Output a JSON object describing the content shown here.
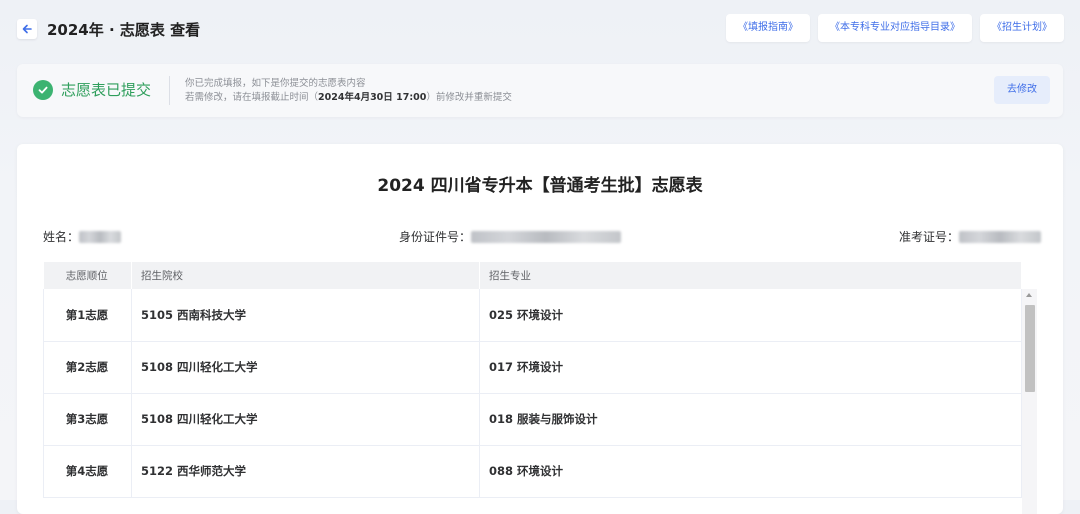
{
  "header": {
    "title": "2024年 · 志愿表 查看",
    "links": [
      "《填报指南》",
      "《本专科专业对应指导目录》",
      "《招生计划》"
    ]
  },
  "status": {
    "title": "志愿表已提交",
    "desc_line1": "你已完成填报，如下是你提交的志愿表内容",
    "desc_line2_prefix": "若需修改，请在填报截止时间（",
    "deadline": "2024年4月30日 17:00",
    "desc_line2_suffix": "）前修改并重新提交",
    "modify_label": "去修改",
    "accent_color": "#3cb371"
  },
  "form": {
    "title": "2024 四川省专升本【普通考生批】志愿表",
    "name_label": "姓名：",
    "id_label": "身份证件号：",
    "exam_label": "准考证号："
  },
  "table": {
    "headers": [
      "志愿顺位",
      "招生院校",
      "招生专业"
    ],
    "rows": [
      [
        "第1志愿",
        "5105 西南科技大学",
        "025 环境设计"
      ],
      [
        "第2志愿",
        "5108 四川轻化工大学",
        "017 环境设计"
      ],
      [
        "第3志愿",
        "5108 四川轻化工大学",
        "018 服装与服饰设计"
      ],
      [
        "第4志愿",
        "5122 西华师范大学",
        "088 环境设计"
      ]
    ]
  }
}
